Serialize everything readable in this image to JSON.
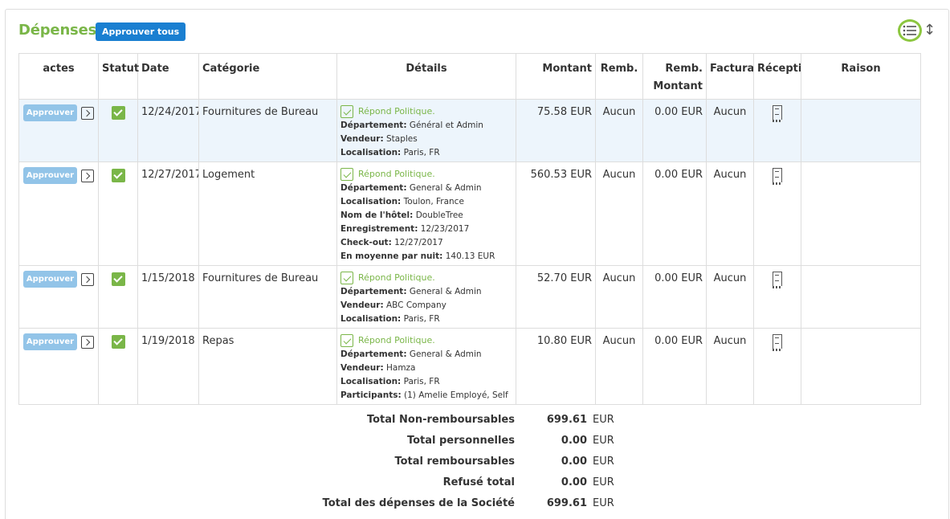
{
  "header": {
    "title": "Dépenses",
    "approve_all_label": "Approuver tous",
    "view_icon": "list-icon",
    "sort_icon": "sort-vertical-icon"
  },
  "columns": [
    "actes",
    "Statut",
    "Date",
    "Catégorie",
    "Détails",
    "Montant",
    "Remb.",
    "Remb. Montant",
    "Facturab",
    "Réceptio",
    "Raison"
  ],
  "rows": [
    {
      "approve_label": "Approuver",
      "date": "12/24/2017",
      "category": "Fournitures de Bureau",
      "policy": "Répond Politique.",
      "details": [
        {
          "k": "Département:",
          "v": "Général et Admin"
        },
        {
          "k": "Vendeur:",
          "v": "Staples"
        },
        {
          "k": "Localisation:",
          "v": "Paris, FR"
        }
      ],
      "amount": "75.58 EUR",
      "reimb": "Aucun",
      "reimb_amount": "0.00 EUR",
      "billable": "Aucun"
    },
    {
      "approve_label": "Approuver",
      "date": "12/27/2017",
      "category": "Logement",
      "policy": "Répond Politique.",
      "details": [
        {
          "k": "Département:",
          "v": "General & Admin"
        },
        {
          "k": "Localisation:",
          "v": "Toulon, France"
        },
        {
          "k": "Nom de l'hôtel:",
          "v": "DoubleTree"
        },
        {
          "k": "Enregistrement:",
          "v": "12/23/2017"
        },
        {
          "k": "Check-out:",
          "v": "12/27/2017"
        },
        {
          "k": "En moyenne par nuit:",
          "v": "140.13 EUR"
        }
      ],
      "amount": "560.53 EUR",
      "reimb": "Aucun",
      "reimb_amount": "0.00 EUR",
      "billable": "Aucun"
    },
    {
      "approve_label": "Approuver",
      "date": "1/15/2018",
      "category": "Fournitures de Bureau",
      "policy": "Répond Politique.",
      "details": [
        {
          "k": "Département:",
          "v": "General & Admin"
        },
        {
          "k": "Vendeur:",
          "v": "ABC Company"
        },
        {
          "k": "Localisation:",
          "v": "Paris, FR"
        }
      ],
      "amount": "52.70 EUR",
      "reimb": "Aucun",
      "reimb_amount": "0.00 EUR",
      "billable": "Aucun"
    },
    {
      "approve_label": "Approuver",
      "date": "1/19/2018",
      "category": "Repas",
      "policy": "Répond Politique.",
      "details": [
        {
          "k": "Département:",
          "v": "General & Admin"
        },
        {
          "k": "Vendeur:",
          "v": "Hamza"
        },
        {
          "k": "Localisation:",
          "v": "Paris, FR"
        },
        {
          "k": "Participants:",
          "v": "(1) Amelie Employé, Self"
        }
      ],
      "amount": "10.80 EUR",
      "reimb": "Aucun",
      "reimb_amount": "0.00 EUR",
      "billable": "Aucun"
    }
  ],
  "totals": [
    {
      "label": "Total Non-remboursables",
      "value": "699.61",
      "currency": "EUR"
    },
    {
      "label": "Total personnelles",
      "value": "0.00",
      "currency": "EUR"
    },
    {
      "label": "Total remboursables",
      "value": "0.00",
      "currency": "EUR"
    },
    {
      "label": "Refusé total",
      "value": "0.00",
      "currency": "EUR"
    },
    {
      "label": "Total des dépenses de la Société",
      "value": "699.61",
      "currency": "EUR"
    }
  ],
  "colors": {
    "accent_green": "#7ab648",
    "primary_blue": "#1a7fd1",
    "approve_blue": "#92c4e8",
    "row_highlight": "#edf5fc"
  }
}
